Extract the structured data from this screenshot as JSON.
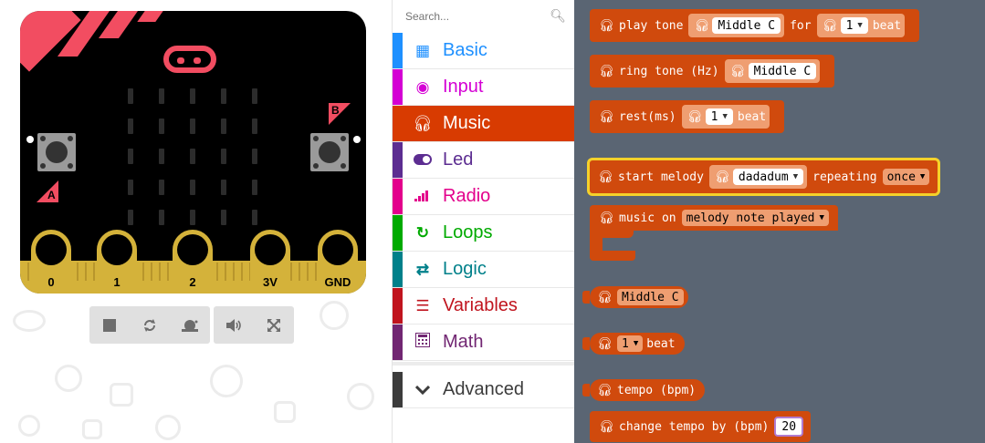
{
  "simulator": {
    "pins": [
      "0",
      "1",
      "2",
      "3V",
      "GND"
    ],
    "button_a_label": "A",
    "button_b_label": "B"
  },
  "toolbox": {
    "search_placeholder": "Search...",
    "categories": [
      {
        "label": "Basic",
        "icon": "grid-icon",
        "color": "#1E90FF"
      },
      {
        "label": "Input",
        "icon": "input-circle-icon",
        "color": "#D400D4"
      },
      {
        "label": "Music",
        "icon": "headphones-icon",
        "color": "#E63022",
        "selected": true
      },
      {
        "label": "Led",
        "icon": "toggle-icon",
        "color": "#5C2D91"
      },
      {
        "label": "Radio",
        "icon": "signal-bars-icon",
        "color": "#E3008C"
      },
      {
        "label": "Loops",
        "icon": "refresh-icon",
        "color": "#00AA00"
      },
      {
        "label": "Logic",
        "icon": "shuffle-icon",
        "color": "#00A4A6"
      },
      {
        "label": "Variables",
        "icon": "list-icon",
        "color": "#DC143C"
      },
      {
        "label": "Math",
        "icon": "calculator-icon",
        "color": "#9400D3"
      }
    ],
    "advanced_label": "Advanced"
  },
  "blocks": {
    "play_tone": {
      "label": "play tone",
      "note": "Middle C",
      "for_label": "for",
      "beat_value": "1",
      "beat_label": "beat"
    },
    "ring_tone": {
      "label": "ring tone (Hz)",
      "note": "Middle C"
    },
    "rest": {
      "label": "rest(ms)",
      "beat_value": "1",
      "beat_label": "beat"
    },
    "start_melody": {
      "label": "start melody",
      "melody": "dadadum",
      "repeating_label": "repeating",
      "repeat_option": "once"
    },
    "music_on": {
      "label": "music on",
      "event": "melody note played"
    },
    "note_reporter": {
      "note": "Middle C"
    },
    "beat_reporter": {
      "beat_value": "1",
      "beat_label": "beat"
    },
    "tempo": {
      "label": "tempo (bpm)"
    },
    "change_tempo": {
      "label": "change tempo by (bpm)",
      "value": "20"
    }
  }
}
